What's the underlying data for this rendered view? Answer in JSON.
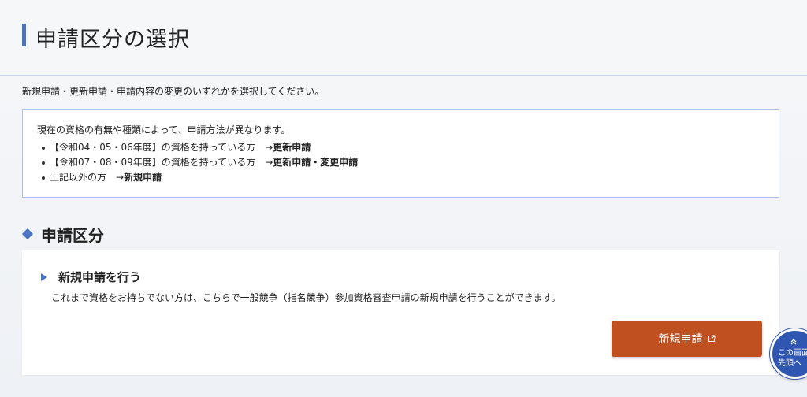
{
  "header": {
    "title": "申請区分の選択"
  },
  "intro": "新規申請・更新申請・申請内容の変更のいずれかを選択してください。",
  "info_box": {
    "lead": "現在の資格の有無や種類によって、申請方法が異なります。",
    "items": [
      {
        "text": "【令和04・05・06年度】の資格を持っている方　→",
        "strong": "更新申請"
      },
      {
        "text": "【令和07・08・09年度】の資格を持っている方　→",
        "strong": "更新申請・変更申請"
      },
      {
        "text": "上記以外の方　→",
        "strong": "新規申請"
      }
    ]
  },
  "section": {
    "title": "申請区分",
    "icon": "diamond-icon"
  },
  "card": {
    "title": "新規申請を行う",
    "description": "これまで資格をお持ちでない方は、こちらで一般競争（指名競争）参加資格審査申請の新規申請を行うことができます。",
    "button_label": "新規申請",
    "button_icon": "external-link-icon",
    "button_color": "#c0501f"
  },
  "back_to_top": {
    "line1": "この画面",
    "line2": "先頭へ",
    "icon": "double-chevron-up-icon",
    "color": "#2f56b0"
  },
  "colors": {
    "accent": "#4a73c2",
    "info_border": "#a9c1e6"
  }
}
